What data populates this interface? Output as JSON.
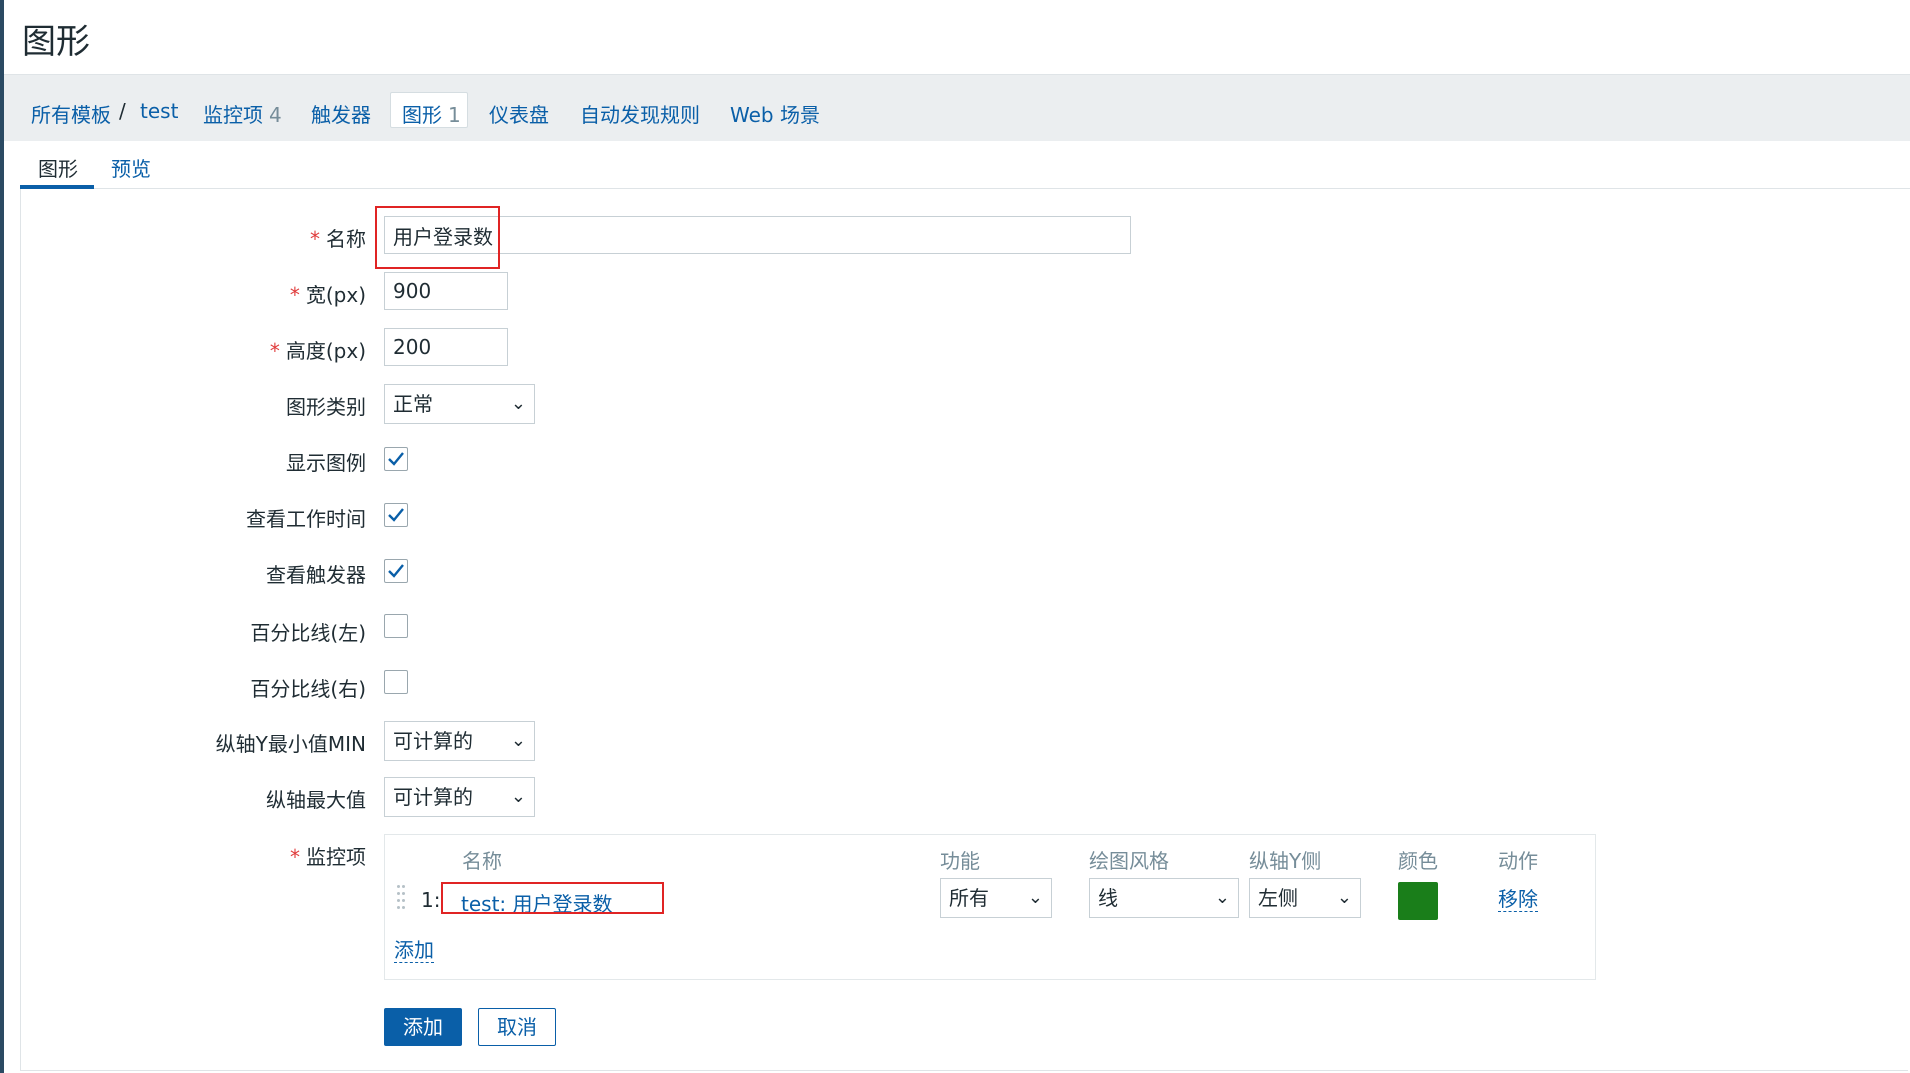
{
  "page": {
    "title": "图形"
  },
  "breadcrumb": {
    "all_templates": "所有模板",
    "separator": "/",
    "template": "test",
    "items_label": "监控项",
    "items_count": "4",
    "triggers": "触发器",
    "graphs_label": "图形",
    "graphs_count": "1",
    "dashboards": "仪表盘",
    "discovery": "自动发现规则",
    "web": "Web 场景"
  },
  "tabs": {
    "graph": "图形",
    "preview": "预览"
  },
  "form": {
    "name_label": "名称",
    "name_value": "用户登录数",
    "width_label": "宽(px)",
    "width_value": "900",
    "height_label": "高度(px)",
    "height_value": "200",
    "graph_type_label": "图形类别",
    "graph_type_value": "正常",
    "show_legend_label": "显示图例",
    "show_working_time_label": "查看工作时间",
    "show_triggers_label": "查看触发器",
    "percentile_left_label": "百分比线(左)",
    "percentile_right_label": "百分比线(右)",
    "ymin_label": "纵轴Y最小值MIN",
    "ymin_value": "可计算的",
    "ymax_label": "纵轴最大值",
    "ymax_value": "可计算的",
    "items_label": "监控项"
  },
  "checkboxes": {
    "show_legend": true,
    "show_working_time": true,
    "show_triggers": true,
    "percentile_left": false,
    "percentile_right": false
  },
  "items_table": {
    "columns": {
      "name": "名称",
      "function": "功能",
      "draw_style": "绘图风格",
      "y_axis_side": "纵轴Y侧",
      "color": "颜色",
      "action": "动作"
    },
    "rows": [
      {
        "index": "1:",
        "name": "test: 用户登录数",
        "function": "所有",
        "draw_style": "线",
        "y_axis_side": "左侧",
        "color": "#1A7E1A",
        "action": "移除"
      }
    ],
    "add_link": "添加"
  },
  "buttons": {
    "add": "添加",
    "cancel": "取消"
  },
  "colors": {
    "accent": "#0A5FA8",
    "required": "#E03C3C",
    "highlight": "#E02424"
  }
}
